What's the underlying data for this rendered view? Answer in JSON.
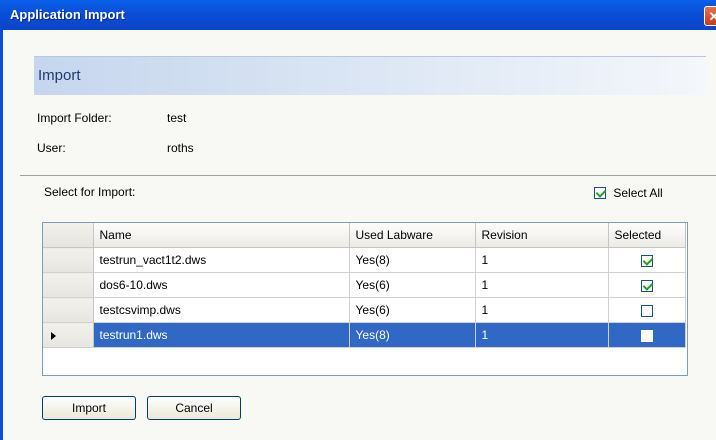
{
  "window": {
    "title": "Application Import",
    "close_glyph": "✕"
  },
  "header": {
    "title": "Import"
  },
  "info": {
    "import_folder_label": "Import Folder:",
    "import_folder_value": "test",
    "user_label": "User:",
    "user_value": "roths"
  },
  "select_label": "Select for Import:",
  "select_all": {
    "label": "Select All",
    "checked": true
  },
  "table": {
    "columns": [
      "Name",
      "Used Labware",
      "Revision",
      "Selected"
    ],
    "rows": [
      {
        "name": "testrun_vact1t2.dws",
        "labware": "Yes(8)",
        "revision": "1",
        "selected": true
      },
      {
        "name": "dos6-10.dws",
        "labware": "Yes(6)",
        "revision": "1",
        "selected": true
      },
      {
        "name": "testcsvimp.dws",
        "labware": "Yes(6)",
        "revision": "1",
        "selected": false
      },
      {
        "name": "testrun1.dws",
        "labware": "Yes(8)",
        "revision": "1",
        "selected": false
      }
    ],
    "active_row": 3
  },
  "buttons": {
    "import_label": "Import",
    "cancel_label": "Cancel"
  },
  "colors": {
    "titlebar": "#0a4fd8",
    "selection": "#3168c6",
    "check": "#21a121"
  }
}
